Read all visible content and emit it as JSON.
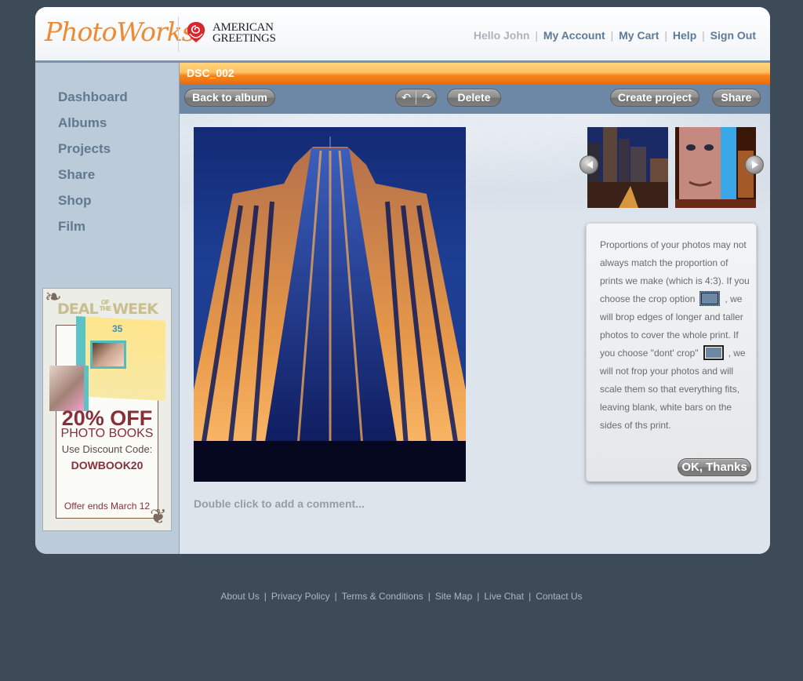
{
  "header": {
    "brand": "PhotoWorks",
    "brand_mark": "®",
    "partner_line1": "AMERICAN",
    "partner_line2": "GREETINGS",
    "greeting": "Hello John",
    "links": [
      "My Account",
      "My Cart",
      "Help",
      "Sign Out"
    ],
    "separator": "|"
  },
  "sidebar": {
    "items": [
      {
        "label": "Dashboard"
      },
      {
        "label": "Albums"
      },
      {
        "label": "Projects"
      },
      {
        "label": "Share"
      },
      {
        "label": "Shop"
      },
      {
        "label": "Film"
      }
    ]
  },
  "ad": {
    "headline_deal": "DEAL",
    "headline_of": "OF",
    "headline_the": "THE",
    "headline_week": "WEEK",
    "book_number": "35",
    "discount": "20% OFF",
    "product": "PHOTO BOOKS",
    "code_label": "Use Discount Code:",
    "code": "DOWBOOK20",
    "expiry": "Offer ends March 12"
  },
  "photo_view": {
    "title": "DSC_002",
    "toolbar": {
      "back": "Back to album",
      "rotate_left_icon": "↶",
      "rotate_right_icon": "↷",
      "delete": "Delete",
      "create_project": "Create project",
      "share": "Share"
    },
    "comment_placeholder": "Double click to add a comment...",
    "thumbnails": [
      {
        "label": "city-night-thumbnail"
      },
      {
        "label": "crown-fountain-thumbnail"
      }
    ]
  },
  "tooltip": {
    "text_1": "Proportions of your photos may not always match the proportion of prints we make (which is 4:3). If you choose the crop option",
    "text_2": ", we will brop edges of longer and taller photos to cover the whole print. If you choose \"dont' crop\"",
    "text_3": ", we will not frop your photos and will scale them so that everything fits, leaving blank, white bars on the sides of ths print.",
    "ok": "OK, Thanks"
  },
  "footer": {
    "links": [
      "About Us",
      "Privacy Policy",
      "Terms & Conditions",
      "Site Map",
      "Live Chat",
      "Contact Us"
    ],
    "separator": "|"
  },
  "colors": {
    "brand_orange": "#ee8a33",
    "title_bar": "#f5851d",
    "toolbar": "#6d88a4",
    "nav_text": "#61798f",
    "page_bg": "#3d4a58",
    "ad_accent": "#86303a"
  }
}
